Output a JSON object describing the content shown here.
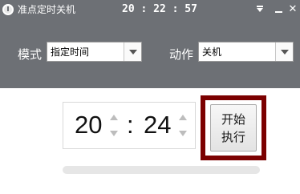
{
  "titlebar": {
    "title": "准点定时关机",
    "clock": "20 : 22 : 57",
    "icons": {
      "app": "power-icon",
      "menu": "menu-dropdown-icon",
      "minimize": "minimize-icon",
      "close": "close-icon"
    },
    "close_glyph": "✕"
  },
  "options": {
    "mode_label": "模式",
    "mode_value": "指定时间",
    "action_label": "动作",
    "action_value": "关机"
  },
  "time": {
    "hour": "20",
    "separator": ":",
    "minute": "24"
  },
  "start_button": {
    "line1": "开始",
    "line2": "执行"
  },
  "progress": {
    "fraction": 0
  },
  "colors": {
    "header_bg": "#6d7075",
    "highlight_border": "#7b0000"
  }
}
